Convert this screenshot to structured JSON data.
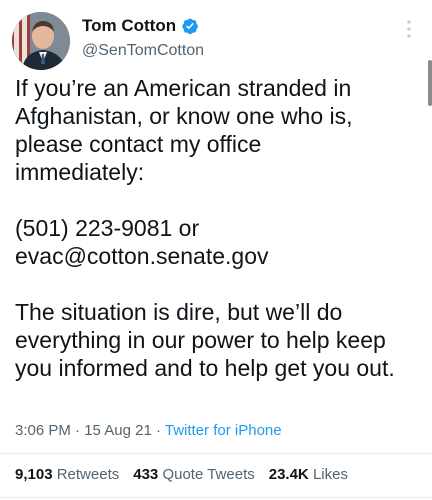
{
  "author": {
    "display_name": "Tom Cotton",
    "handle": "@SenTomCotton",
    "verified": true,
    "verified_color": "#1d9bf0"
  },
  "tweet": {
    "paragraph_1": [
      "If you’re an American stranded in",
      "Afghanistan, or know one who is,",
      "please contact my office",
      "immediately:"
    ],
    "paragraph_2": [
      "(501) 223-9081 or",
      "evac@cotton.senate.gov"
    ],
    "paragraph_3": [
      "The situation is dire, but we’ll do",
      "everything in our power to help keep",
      "you informed and to help get you out."
    ]
  },
  "meta": {
    "time": "3:06 PM",
    "separator": "·",
    "date": "15 Aug 21",
    "source": "Twitter for iPhone",
    "source_color": "#1d9bf0"
  },
  "stats": {
    "retweets_count": "9,103",
    "retweets_label": "Retweets",
    "quotes_count": "433",
    "quotes_label": "Quote Tweets",
    "likes_count": "23.4K",
    "likes_label": "Likes"
  },
  "icons": {
    "more": "more-vertical-icon",
    "verified": "verified-badge-icon"
  }
}
